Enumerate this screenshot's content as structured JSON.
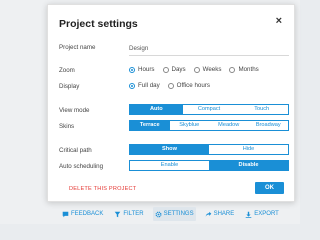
{
  "dialog": {
    "title": "Project settings",
    "close_glyph": "×",
    "project_name": {
      "label": "Project name",
      "value": "Design"
    },
    "zoom": {
      "label": "Zoom",
      "options": [
        "Hours",
        "Days",
        "Weeks",
        "Months"
      ],
      "selected": "Hours"
    },
    "display": {
      "label": "Display",
      "options": [
        "Full day",
        "Office hours"
      ],
      "selected": "Full day"
    },
    "view_mode": {
      "label": "View mode",
      "options": [
        "Auto",
        "Compact",
        "Touch"
      ],
      "selected": "Auto"
    },
    "skins": {
      "label": "Skins",
      "options": [
        "Terrace",
        "Skyblue",
        "Meadow",
        "Broadway"
      ],
      "selected": "Terrace"
    },
    "critical_path": {
      "label": "Critical path",
      "options": [
        "Show",
        "Hide"
      ],
      "selected": "Show"
    },
    "auto_scheduling": {
      "label": "Auto scheduling",
      "options": [
        "Enable",
        "Disable"
      ],
      "selected": "Disable"
    },
    "delete_label": "DELETE THIS PROJECT",
    "ok_label": "OK"
  },
  "toolbar": {
    "items": [
      {
        "label": "FEEDBACK",
        "icon": "chat-icon"
      },
      {
        "label": "FILTER",
        "icon": "filter-icon"
      },
      {
        "label": "SETTINGS",
        "icon": "gear-icon",
        "active": true
      },
      {
        "label": "SHARE",
        "icon": "share-icon"
      },
      {
        "label": "EXPORT",
        "icon": "download-icon"
      }
    ]
  },
  "colors": {
    "accent": "#1a8fd6",
    "danger": "#e53935"
  }
}
